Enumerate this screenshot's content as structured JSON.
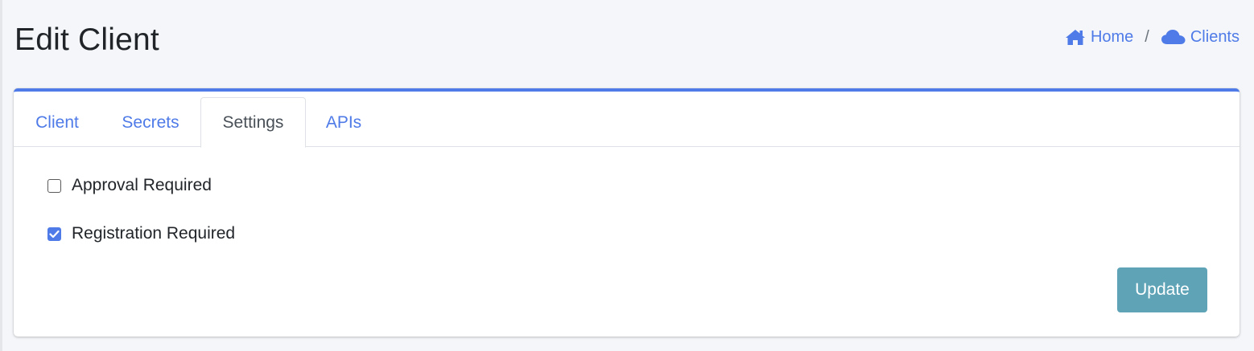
{
  "header": {
    "title": "Edit Client",
    "breadcrumb": {
      "home_label": "Home",
      "separator": "/",
      "clients_label": "Clients"
    }
  },
  "tabs": [
    {
      "label": "Client",
      "active": false
    },
    {
      "label": "Secrets",
      "active": false
    },
    {
      "label": "Settings",
      "active": true
    },
    {
      "label": "APIs",
      "active": false
    }
  ],
  "settings": {
    "approval_required": {
      "label": "Approval Required",
      "checked": false
    },
    "registration_required": {
      "label": "Registration Required",
      "checked": true
    }
  },
  "actions": {
    "update_label": "Update"
  },
  "colors": {
    "accent": "#4f7be8",
    "update_button": "#5fa3b7",
    "background": "#f4f6f9"
  },
  "icons": {
    "home": "home-icon",
    "clients": "cloud-icon"
  }
}
